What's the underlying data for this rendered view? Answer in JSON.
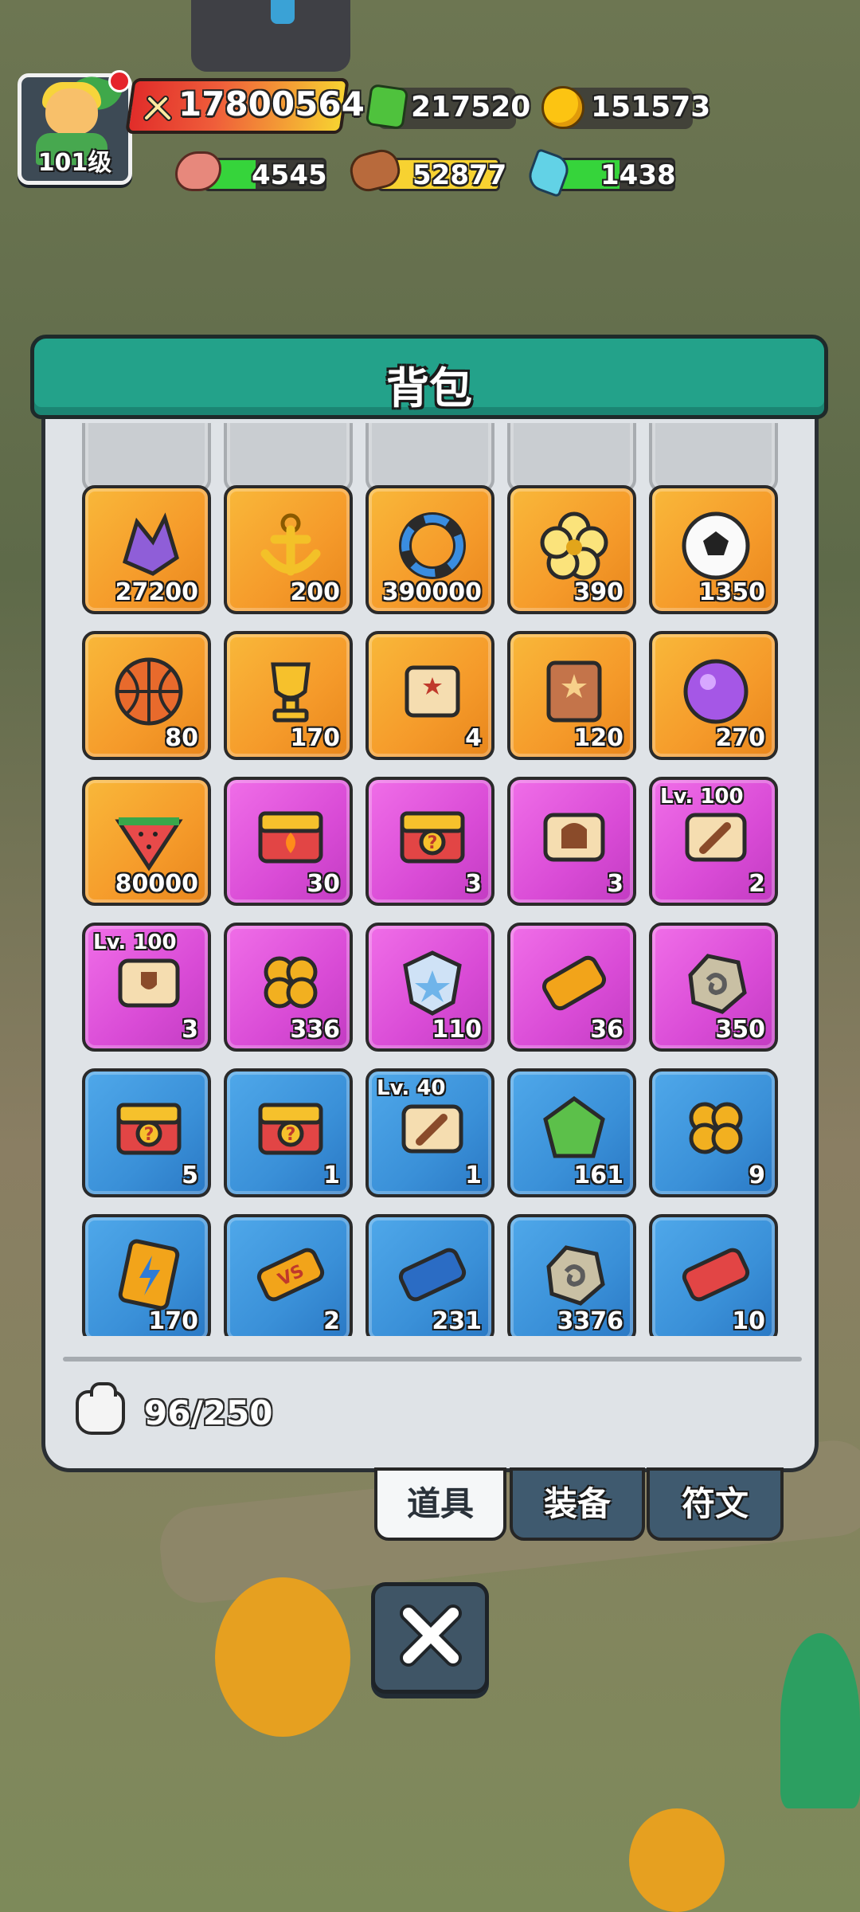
{
  "hud": {
    "player_level": "101级",
    "power": "17800564",
    "gems": "217520",
    "coins": "151573",
    "meat": "4545",
    "wood": "52877",
    "crystal": "1438",
    "colors": {
      "meat_bar": "#36d43b",
      "wood_bar": "#f7d231",
      "crystal_bar": "#36d43b"
    },
    "icons": [
      "power-icon",
      "gem-icon",
      "coin-icon",
      "meat-icon",
      "wood-icon",
      "crystal-icon"
    ]
  },
  "panel": {
    "title": "背包",
    "capacity": "96/250",
    "items": [
      {
        "name": "purple-crystal-icon",
        "rarity": "orange",
        "count": "27200",
        "lvl": ""
      },
      {
        "name": "anchor-icon",
        "rarity": "orange",
        "count": "200",
        "lvl": ""
      },
      {
        "name": "ring-icon",
        "rarity": "orange",
        "count": "390000",
        "lvl": ""
      },
      {
        "name": "flower-icon",
        "rarity": "orange",
        "count": "390",
        "lvl": ""
      },
      {
        "name": "soccer-ball-icon",
        "rarity": "orange",
        "count": "1350",
        "lvl": ""
      },
      {
        "name": "basketball-icon",
        "rarity": "orange",
        "count": "80",
        "lvl": ""
      },
      {
        "name": "trophy-icon",
        "rarity": "orange",
        "count": "170",
        "lvl": ""
      },
      {
        "name": "star-scroll-icon",
        "rarity": "orange",
        "count": "4",
        "lvl": ""
      },
      {
        "name": "star-book-icon",
        "rarity": "orange",
        "count": "120",
        "lvl": ""
      },
      {
        "name": "purple-orb-icon",
        "rarity": "orange",
        "count": "270",
        "lvl": ""
      },
      {
        "name": "watermelon-icon",
        "rarity": "orange",
        "count": "80000",
        "lvl": ""
      },
      {
        "name": "fire-chest-icon",
        "rarity": "purple",
        "count": "30",
        "lvl": ""
      },
      {
        "name": "mystery-chest-icon",
        "rarity": "purple",
        "count": "3",
        "lvl": ""
      },
      {
        "name": "helmet-scroll-icon",
        "rarity": "purple",
        "count": "3",
        "lvl": ""
      },
      {
        "name": "sword-scroll-icon",
        "rarity": "purple",
        "count": "2",
        "lvl": "Lv. 100"
      },
      {
        "name": "shield-scroll-icon",
        "rarity": "purple",
        "count": "3",
        "lvl": "Lv. 100"
      },
      {
        "name": "clover-icon",
        "rarity": "purple",
        "count": "336",
        "lvl": ""
      },
      {
        "name": "star-badge-icon",
        "rarity": "purple",
        "count": "110",
        "lvl": ""
      },
      {
        "name": "ticket-icon",
        "rarity": "purple",
        "count": "36",
        "lvl": ""
      },
      {
        "name": "rune-stone-icon",
        "rarity": "purple",
        "count": "350",
        "lvl": ""
      },
      {
        "name": "mystery-chest-icon",
        "rarity": "blue",
        "count": "5",
        "lvl": ""
      },
      {
        "name": "mystery-chest-icon",
        "rarity": "blue",
        "count": "1",
        "lvl": ""
      },
      {
        "name": "sword-scroll-icon",
        "rarity": "blue",
        "count": "1",
        "lvl": "Lv. 40"
      },
      {
        "name": "green-gem-icon",
        "rarity": "blue",
        "count": "161",
        "lvl": ""
      },
      {
        "name": "clover-icon",
        "rarity": "blue",
        "count": "9",
        "lvl": ""
      },
      {
        "name": "lightning-card-icon",
        "rarity": "blue",
        "count": "170",
        "lvl": ""
      },
      {
        "name": "vs-ticket-icon",
        "rarity": "blue",
        "count": "2",
        "lvl": ""
      },
      {
        "name": "blue-ticket-icon",
        "rarity": "blue",
        "count": "231",
        "lvl": ""
      },
      {
        "name": "rune-stone-icon",
        "rarity": "blue",
        "count": "3376",
        "lvl": ""
      },
      {
        "name": "red-ticket-icon",
        "rarity": "blue",
        "count": "10",
        "lvl": ""
      }
    ]
  },
  "tabs": [
    {
      "label": "道具",
      "active": true
    },
    {
      "label": "装备",
      "active": false
    },
    {
      "label": "符文",
      "active": false
    }
  ]
}
